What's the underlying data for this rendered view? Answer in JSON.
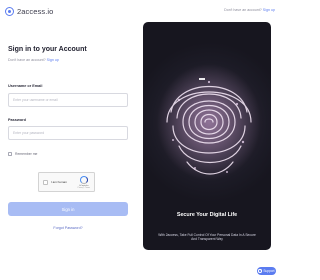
{
  "brand": {
    "name": "2access.io"
  },
  "header": {
    "signup_prompt": "Don't have an account?",
    "signup_link": "Sign up"
  },
  "form": {
    "title": "Sign in to your Account",
    "subtitle_prompt": "Don't have an account?",
    "subtitle_link": "Sign up",
    "username_label": "Username or Email",
    "username_placeholder": "Enter your username or email",
    "username_value": "",
    "password_label": "Password",
    "password_placeholder": "Enter your password",
    "password_value": "",
    "remember_label": "Remember me",
    "remember_checked": false,
    "signin_label": "Sign in",
    "forgot_label": "Forgot Password?"
  },
  "captcha": {
    "label": "I am human",
    "brand": "hCaptcha",
    "links": "Privacy - Terms"
  },
  "hero": {
    "title": "Secure Your Digital Life",
    "description": "With 2access, Take Full Control Of Your Personal Data In A Secure And Transparent Way"
  },
  "support": {
    "label": "Support",
    "icon": "question-icon"
  },
  "colors": {
    "accent": "#5b7cf0",
    "button_disabled": "#a8bcf4",
    "hero_bg": "#1c1b26"
  }
}
